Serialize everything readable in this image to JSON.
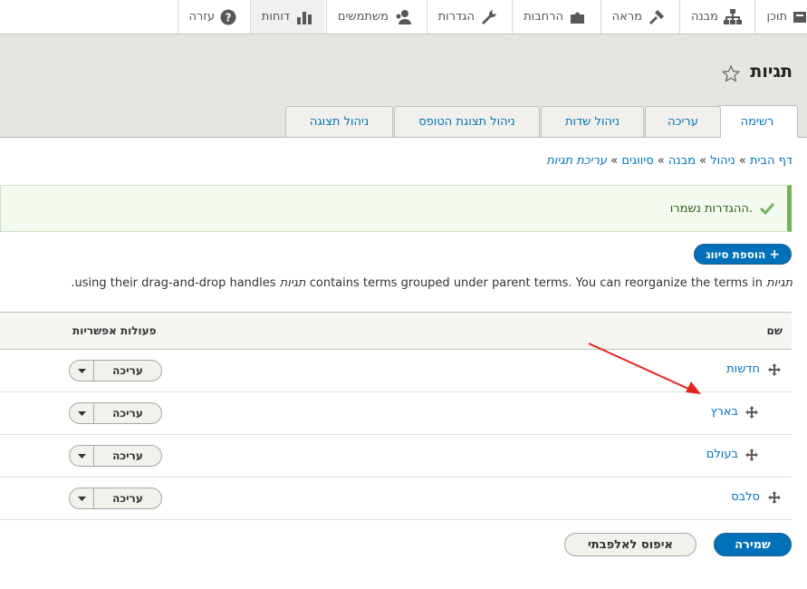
{
  "toolbar": {
    "items": [
      {
        "label": "תוכן",
        "icon": "content-icon"
      },
      {
        "label": "מבנה",
        "icon": "structure-icon"
      },
      {
        "label": "מראה",
        "icon": "appearance-icon"
      },
      {
        "label": "הרחבות",
        "icon": "extend-icon"
      },
      {
        "label": "הגדרות",
        "icon": "wrench-icon"
      },
      {
        "label": "משתמשים",
        "icon": "people-icon"
      },
      {
        "label": "דוחות",
        "icon": "reports-icon"
      },
      {
        "label": "עזרה",
        "icon": "help-icon"
      }
    ]
  },
  "header": {
    "title": "תגיות",
    "tabs": [
      {
        "label": "רשימה"
      },
      {
        "label": "עריכה"
      },
      {
        "label": "ניהול שדות"
      },
      {
        "label": "ניהול תצוגת הטופס"
      },
      {
        "label": "ניהול תצוגה"
      }
    ]
  },
  "breadcrumb": {
    "items": [
      "דף הבית",
      "ניהול",
      "מבנה",
      "סיווגים"
    ],
    "current": "עריכת תגיות",
    "separator": "»"
  },
  "message": {
    "text": "ההגדרות נשמרו."
  },
  "add_button": {
    "label": "הוספת סיווג",
    "plus": "+"
  },
  "description": {
    "italic": "תגיות",
    "text": "contains terms grouped under parent terms. You can reorganize the terms in",
    "italic2": "תגיות",
    "text2": "using their drag-and-drop handles."
  },
  "table": {
    "col_name": "שם",
    "col_ops": "פעולות אפשריות",
    "rows": [
      {
        "name": "חדשות",
        "action": "עריכה",
        "indent": 0
      },
      {
        "name": "בארץ",
        "action": "עריכה",
        "indent": 1
      },
      {
        "name": "בעולם",
        "action": "עריכה",
        "indent": 1
      },
      {
        "name": "סלבס",
        "action": "עריכה",
        "indent": 0
      }
    ]
  },
  "buttons": {
    "save": "שמירה",
    "reset": "איפוס לאלפבתי"
  },
  "colors": {
    "accent": "#0071b8",
    "link": "#0074bd",
    "success": "#77b259",
    "annotation": "#e8231f"
  }
}
